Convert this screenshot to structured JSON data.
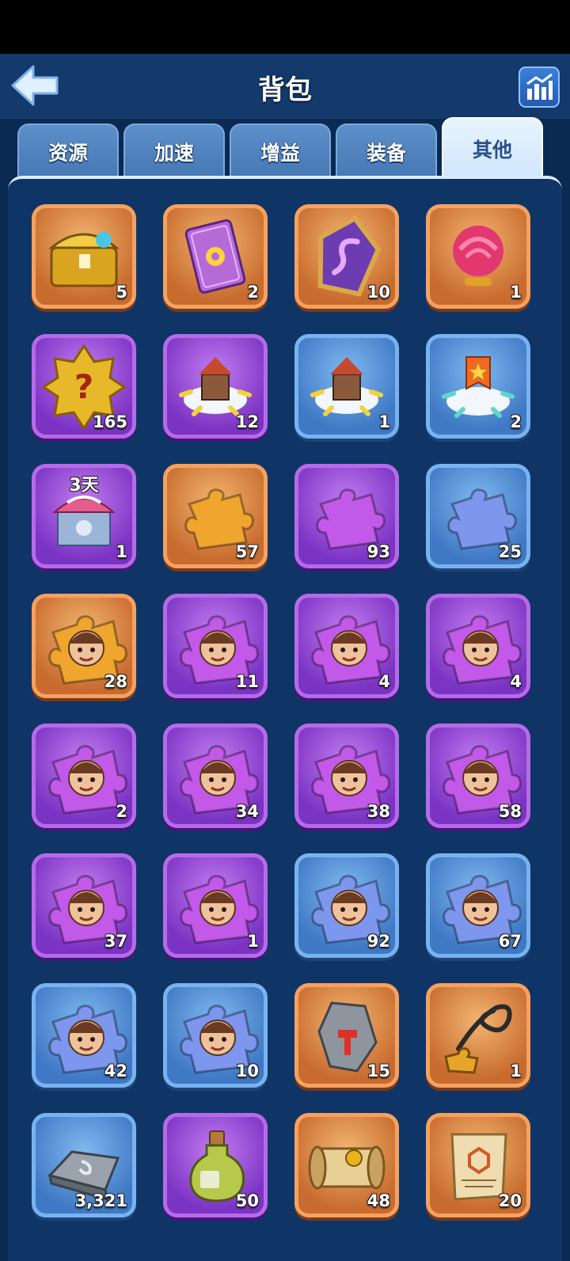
{
  "header": {
    "title": "背包",
    "back_icon": "back-arrow-icon",
    "stats_icon": "bar-chart-icon"
  },
  "tabs": [
    {
      "label": "资源",
      "active": false
    },
    {
      "label": "加速",
      "active": false
    },
    {
      "label": "增益",
      "active": false
    },
    {
      "label": "装备",
      "active": false
    },
    {
      "label": "其他",
      "active": true
    }
  ],
  "colors": {
    "orange_frame": "#f5a15f",
    "purple_frame": "#b56be8",
    "blue_frame": "#78b3f0",
    "panel": "#0f3566"
  },
  "items": [
    {
      "icon": "treasure-chest-icon",
      "rarity": "orange",
      "count": "5"
    },
    {
      "icon": "card-icon",
      "rarity": "orange",
      "count": "2"
    },
    {
      "icon": "rune-stone-icon",
      "rarity": "orange",
      "count": "10"
    },
    {
      "icon": "rose-icon",
      "rarity": "orange",
      "count": "1"
    },
    {
      "icon": "mystery-badge-icon",
      "rarity": "purple",
      "count": "165"
    },
    {
      "icon": "city-relocation-icon",
      "rarity": "purple",
      "count": "12"
    },
    {
      "icon": "city-relocation-icon",
      "rarity": "blue",
      "count": "1"
    },
    {
      "icon": "banner-relocation-icon",
      "rarity": "blue",
      "count": "2"
    },
    {
      "icon": "carousel-building-icon",
      "rarity": "purple",
      "count": "1",
      "timer": "3天"
    },
    {
      "icon": "puzzle-piece-icon",
      "rarity": "orange",
      "count": "57"
    },
    {
      "icon": "puzzle-piece-icon",
      "rarity": "purple",
      "count": "93"
    },
    {
      "icon": "puzzle-piece-icon",
      "rarity": "blue",
      "count": "25"
    },
    {
      "icon": "hero-fragment-icon",
      "rarity": "orange",
      "count": "28"
    },
    {
      "icon": "hero-fragment-icon",
      "rarity": "purple",
      "count": "11"
    },
    {
      "icon": "hero-fragment-icon",
      "rarity": "purple",
      "count": "4"
    },
    {
      "icon": "hero-fragment-icon",
      "rarity": "purple",
      "count": "4"
    },
    {
      "icon": "hero-fragment-icon",
      "rarity": "purple",
      "count": "2"
    },
    {
      "icon": "hero-fragment-icon",
      "rarity": "purple",
      "count": "34"
    },
    {
      "icon": "hero-fragment-icon",
      "rarity": "purple",
      "count": "38"
    },
    {
      "icon": "hero-fragment-icon",
      "rarity": "purple",
      "count": "58"
    },
    {
      "icon": "hero-fragment-icon",
      "rarity": "purple",
      "count": "37"
    },
    {
      "icon": "hero-fragment-icon",
      "rarity": "purple",
      "count": "1"
    },
    {
      "icon": "hero-fragment-icon",
      "rarity": "blue",
      "count": "92"
    },
    {
      "icon": "hero-fragment-icon",
      "rarity": "blue",
      "count": "67"
    },
    {
      "icon": "hero-fragment-icon",
      "rarity": "blue",
      "count": "42"
    },
    {
      "icon": "hero-fragment-icon",
      "rarity": "blue",
      "count": "10"
    },
    {
      "icon": "hammer-stone-icon",
      "rarity": "orange",
      "count": "15"
    },
    {
      "icon": "whip-puzzle-icon",
      "rarity": "orange",
      "count": "1"
    },
    {
      "icon": "iron-ingot-icon",
      "rarity": "blue",
      "count": "3,321"
    },
    {
      "icon": "potion-bottle-icon",
      "rarity": "purple",
      "count": "50"
    },
    {
      "icon": "scroll-icon",
      "rarity": "orange",
      "count": "48"
    },
    {
      "icon": "map-parchment-icon",
      "rarity": "orange",
      "count": "20"
    }
  ]
}
